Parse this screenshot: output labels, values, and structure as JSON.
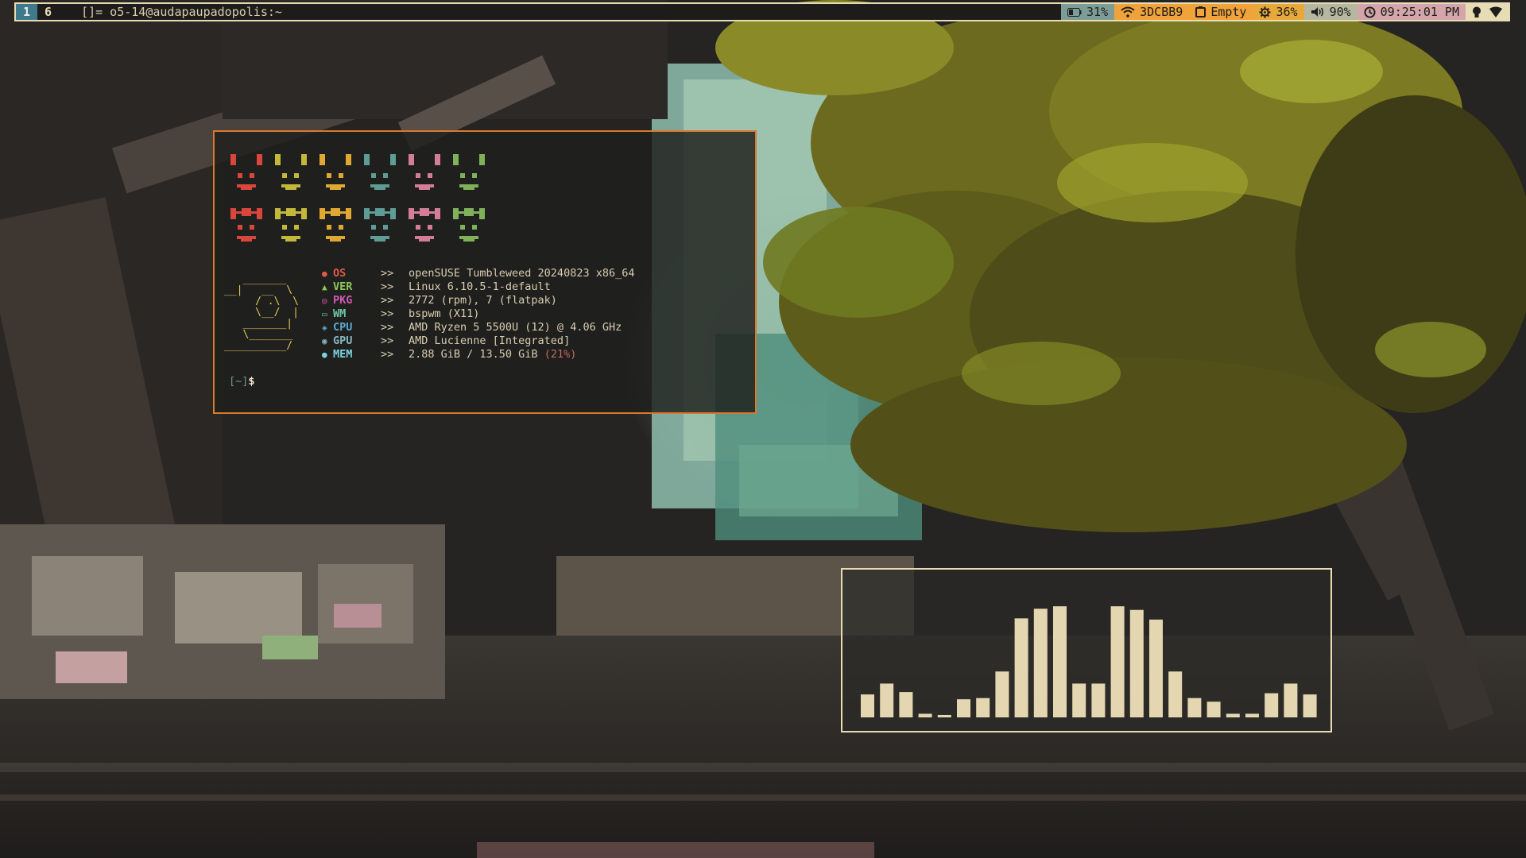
{
  "topbar": {
    "workspaces": [
      {
        "label": "1",
        "active": true
      },
      {
        "label": "6",
        "active": false
      }
    ],
    "window_title": "[]= o5-14@audapaupadopolis:~",
    "modules": {
      "battery": {
        "icon": "battery-icon",
        "value": "31%"
      },
      "wifi": {
        "icon": "wifi-icon",
        "value": "3DCBB9"
      },
      "clipboard": {
        "icon": "clipboard-icon",
        "value": "Empty"
      },
      "cpu": {
        "icon": "gear-icon",
        "value": "36%"
      },
      "volume": {
        "icon": "speaker-icon",
        "value": "90%"
      },
      "clock": {
        "icon": "clock-icon",
        "value": "09:25:01 PM"
      },
      "tray": [
        "lightbulb-icon",
        "network-icon"
      ]
    }
  },
  "terminal": {
    "sysinfo": [
      {
        "icon": "os-icon",
        "label": "OS",
        "sep": ">>",
        "value": "openSUSE Tumbleweed 20240823 x86_64",
        "color": "#e05a4a"
      },
      {
        "icon": "version-icon",
        "label": "VER",
        "sep": ">>",
        "value": "Linux 6.10.5-1-default",
        "color": "#8ec85a"
      },
      {
        "icon": "package-icon",
        "label": "PKG",
        "sep": ">>",
        "value": "2772 (rpm), 7 (flatpak)",
        "color": "#d45ab4"
      },
      {
        "icon": "monitor-icon",
        "label": "WM",
        "sep": ">>",
        "value": "bspwm (X11)",
        "color": "#6ac8a8"
      },
      {
        "icon": "chip-icon",
        "label": "CPU",
        "sep": ">>",
        "value": "AMD Ryzen 5 5500U (12) @ 4.06 GHz",
        "color": "#5aaad4"
      },
      {
        "icon": "gpu-icon",
        "label": "GPU",
        "sep": ">>",
        "value": "AMD Lucienne [Integrated]",
        "color": "#8ab8c0"
      },
      {
        "icon": "memory-icon",
        "label": "MEM",
        "sep": ">>",
        "value": "2.88 GiB / 13.50 GiB",
        "pct": "(21%)",
        "color": "#7ad4e0"
      }
    ],
    "prompt_dir": "[~]",
    "prompt_symbol": "$",
    "palette": [
      "#d9473c",
      "#c3b83a",
      "#e0a832",
      "#5f9c96",
      "#d47d9a",
      "#7fb05a"
    ]
  },
  "visualizer": {
    "bar_color": "#e4d6b0",
    "levels": [
      0.19,
      0.28,
      0.21,
      0.03,
      0.02,
      0.15,
      0.16,
      0.38,
      0.82,
      0.9,
      0.92,
      0.28,
      0.28,
      0.92,
      0.89,
      0.81,
      0.38,
      0.16,
      0.13,
      0.03,
      0.03,
      0.2,
      0.28,
      0.19
    ]
  }
}
